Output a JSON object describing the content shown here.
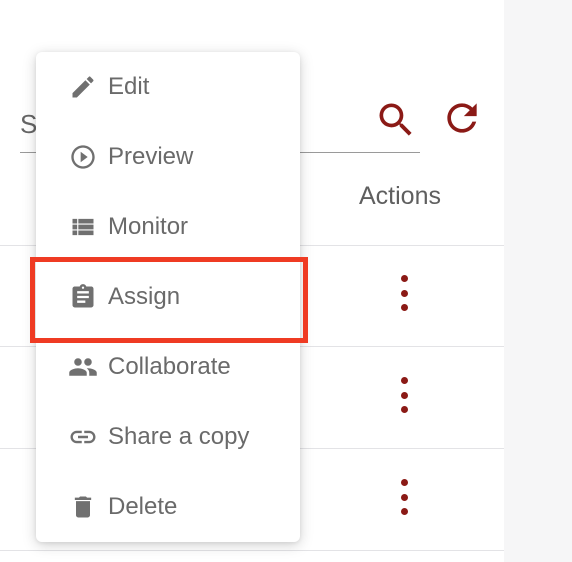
{
  "search": {
    "placeholder": "Search"
  },
  "table": {
    "actions_header": "Actions",
    "rows": [
      {
        "actions_label": "more-actions"
      },
      {
        "actions_label": "more-actions"
      },
      {
        "actions_label": "more-actions"
      }
    ]
  },
  "menu": {
    "items": [
      {
        "label": "Edit",
        "icon": "pencil-icon"
      },
      {
        "label": "Preview",
        "icon": "play-circle-icon"
      },
      {
        "label": "Monitor",
        "icon": "list-icon"
      },
      {
        "label": "Assign",
        "icon": "clipboard-icon"
      },
      {
        "label": "Collaborate",
        "icon": "people-icon"
      },
      {
        "label": "Share a copy",
        "icon": "link-icon"
      },
      {
        "label": "Delete",
        "icon": "trash-icon"
      }
    ],
    "highlighted_item": "Assign"
  },
  "colors": {
    "accent": "#8b1a16",
    "highlight": "#ef3b23",
    "menu_text": "#6a6a6a",
    "menu_icon": "#707070"
  }
}
